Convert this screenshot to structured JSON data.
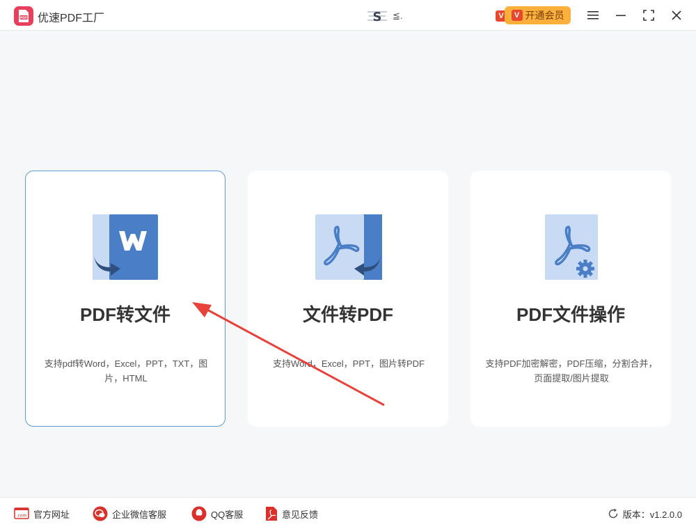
{
  "app": {
    "title": "优速PDF工厂",
    "user_name": "≦.",
    "vip_badge": "V",
    "vip_button": "开通会员"
  },
  "cards": [
    {
      "title": "PDF转文件",
      "desc": "支持pdf转Word，Excel，PPT，TXT，图片，HTML",
      "icon": "word-doc-icon"
    },
    {
      "title": "文件转PDF",
      "desc": "支持Word，Excel，PPT，图片转PDF",
      "icon": "pdf-convert-icon"
    },
    {
      "title": "PDF文件操作",
      "desc": "支持PDF加密解密，PDF压缩，分割合并，页面提取/图片提取",
      "icon": "pdf-settings-icon"
    }
  ],
  "footer": {
    "website": "官方网址",
    "wechat": "企业微信客服",
    "qq": "QQ客服",
    "feedback": "意见反馈",
    "version": "版本：v1.2.0.0",
    "website_icon_text": ".com"
  },
  "colors": {
    "accent": "#5b9bd5",
    "vip": "#fbb03b",
    "brand": "#e83f5c",
    "annotation_arrow": "#e8433a"
  }
}
